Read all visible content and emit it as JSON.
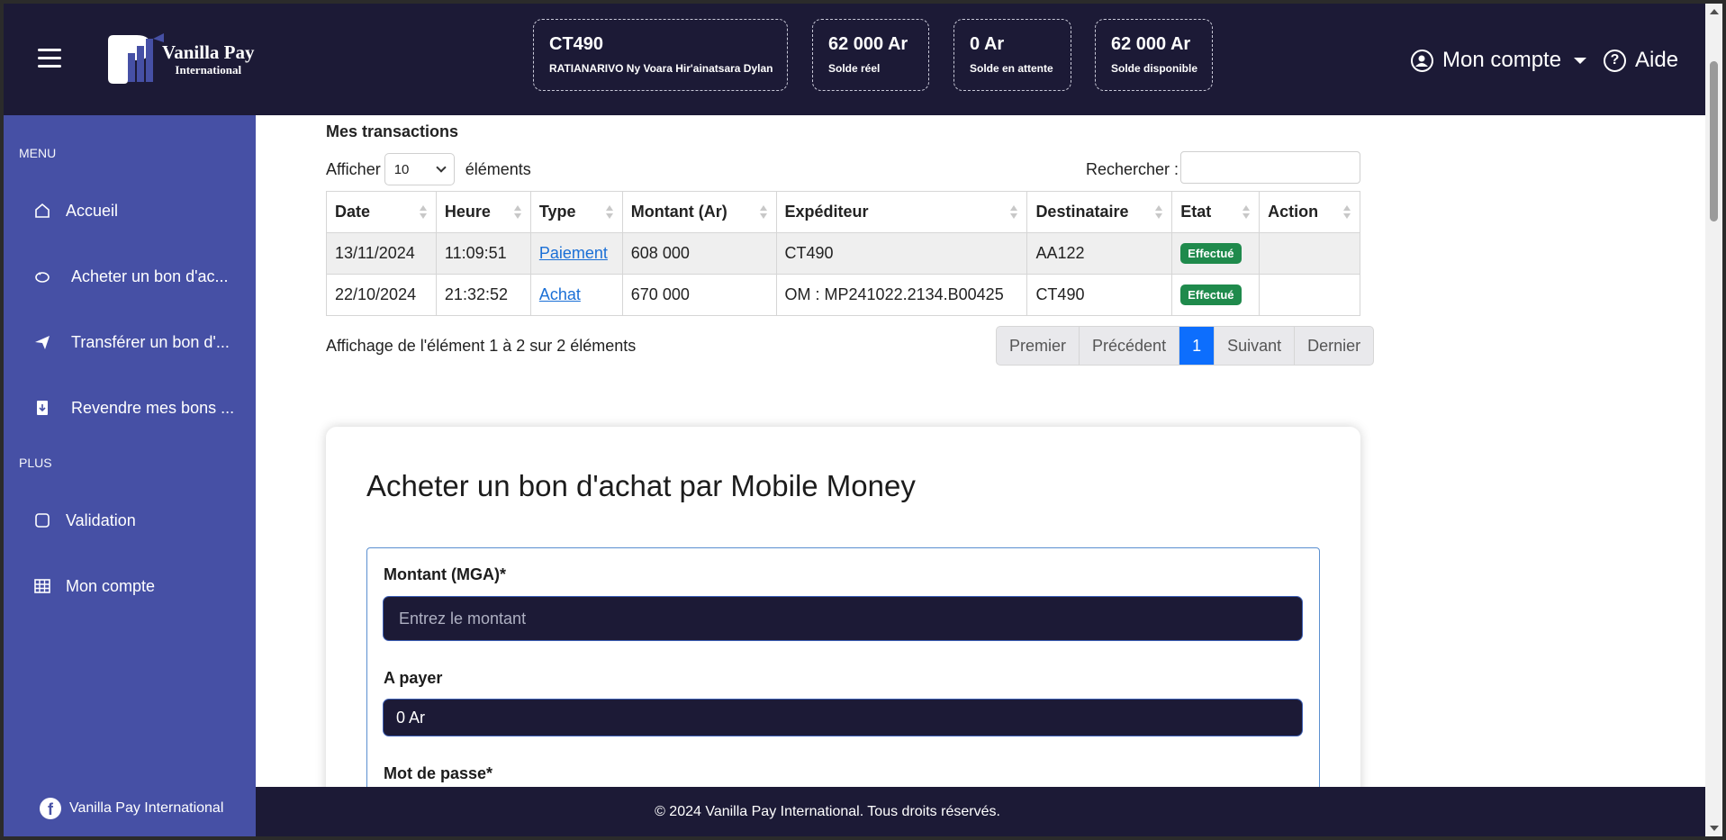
{
  "header": {
    "logo": {
      "line1": "Vanilla Pay",
      "line2": "International"
    },
    "account_card": {
      "code": "CT490",
      "name": "RATIANARIVO Ny Voara Hir'ainatsara Dylan"
    },
    "balances": [
      {
        "value": "62 000 Ar",
        "label": "Solde réel"
      },
      {
        "value": "0 Ar",
        "label": "Solde en attente"
      },
      {
        "value": "62 000 Ar",
        "label": "Solde disponible"
      }
    ],
    "account_label": "Mon compte",
    "help_label": "Aide"
  },
  "sidebar": {
    "menu_label": "MENU",
    "plus_label": "PLUS",
    "items": [
      {
        "label": "Accueil",
        "icon": "home-icon"
      },
      {
        "label": "Acheter un bon d'ac...",
        "icon": "piggy-bank-icon"
      },
      {
        "label": "Transférer un bon d'...",
        "icon": "send-icon"
      },
      {
        "label": "Revendre mes bons ...",
        "icon": "receipt-icon"
      }
    ],
    "plus_items": [
      {
        "label": "Validation",
        "icon": "square-icon"
      },
      {
        "label": "Mon compte",
        "icon": "table-icon"
      }
    ],
    "social": "Vanilla Pay International"
  },
  "transactions": {
    "title": "Mes transactions",
    "show_label": "Afficher",
    "page_size": "10",
    "elements_label": "éléments",
    "search_label": "Rechercher :",
    "columns": [
      "Date",
      "Heure",
      "Type",
      "Montant (Ar)",
      "Expéditeur",
      "Destinataire",
      "Etat",
      "Action"
    ],
    "rows": [
      {
        "date": "13/11/2024",
        "heure": "11:09:51",
        "type": "Paiement",
        "montant": "608 000",
        "expediteur": "CT490",
        "destinataire": "AA122",
        "etat": "Effectué",
        "action": ""
      },
      {
        "date": "22/10/2024",
        "heure": "21:32:52",
        "type": "Achat",
        "montant": "670 000",
        "expediteur": "OM : MP241022.2134.B00425",
        "destinataire": "CT490",
        "etat": "Effectué",
        "action": ""
      }
    ],
    "info": "Affichage de l'élément 1 à 2 sur 2 éléments",
    "pagination": {
      "first": "Premier",
      "prev": "Précédent",
      "current": "1",
      "next": "Suivant",
      "last": "Dernier"
    }
  },
  "purchase_form": {
    "title": "Acheter un bon d'achat par Mobile Money",
    "amount_label": "Montant (MGA)*",
    "amount_placeholder": "Entrez le montant",
    "pay_label": "A payer",
    "pay_value": "0 Ar",
    "password_label": "Mot de passe*"
  },
  "footer": {
    "text": "© 2024 Vanilla Pay International. Tous droits réservés."
  },
  "colors": {
    "header": "#1c1a36",
    "sidebar": "#4650a5",
    "badge": "#1f8a4c",
    "active_page": "#0d6efd",
    "link": "#1a6fd6"
  }
}
